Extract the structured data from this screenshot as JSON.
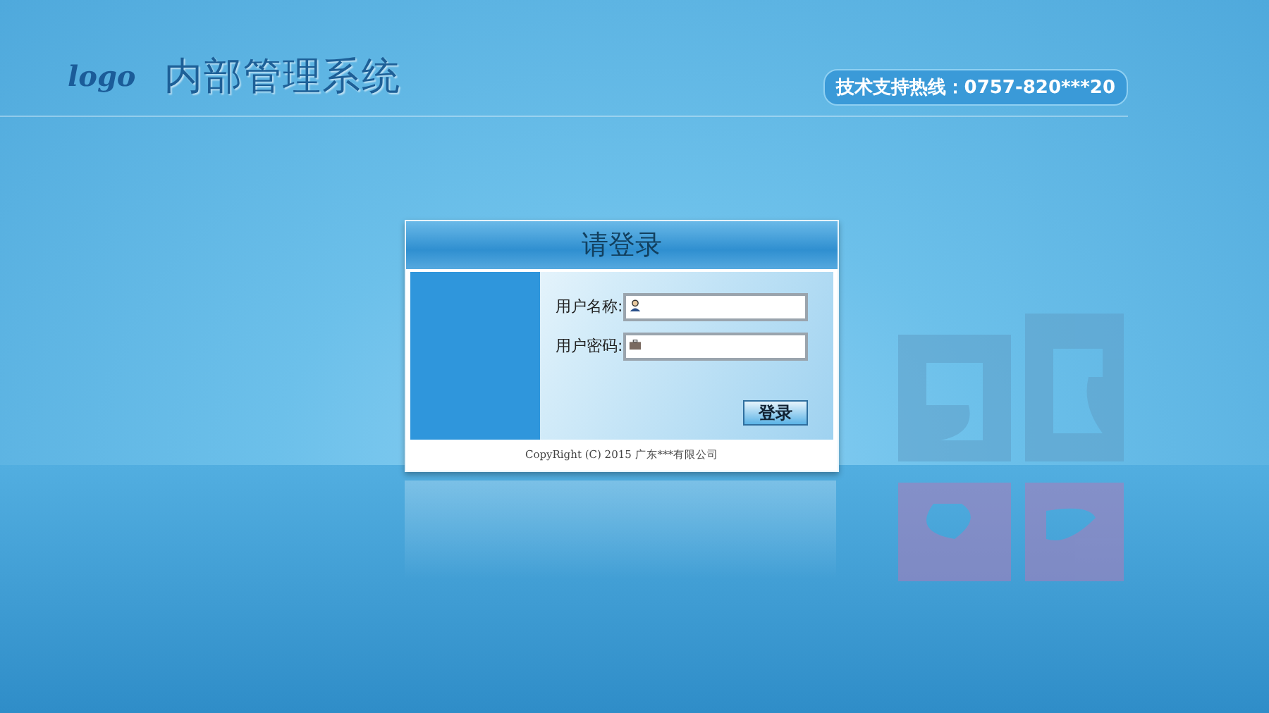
{
  "header": {
    "logo": "logo",
    "title": "内部管理系统",
    "hotline": "技术支持热线：0757-820***20"
  },
  "login": {
    "title": "请登录",
    "fields": [
      {
        "kind": "user",
        "label": "用户名称:"
      },
      {
        "kind": "password",
        "label": "用户密码:"
      }
    ],
    "submit": "登录",
    "copyright": "CopyRight (C) 2015 广东***有限公司"
  }
}
